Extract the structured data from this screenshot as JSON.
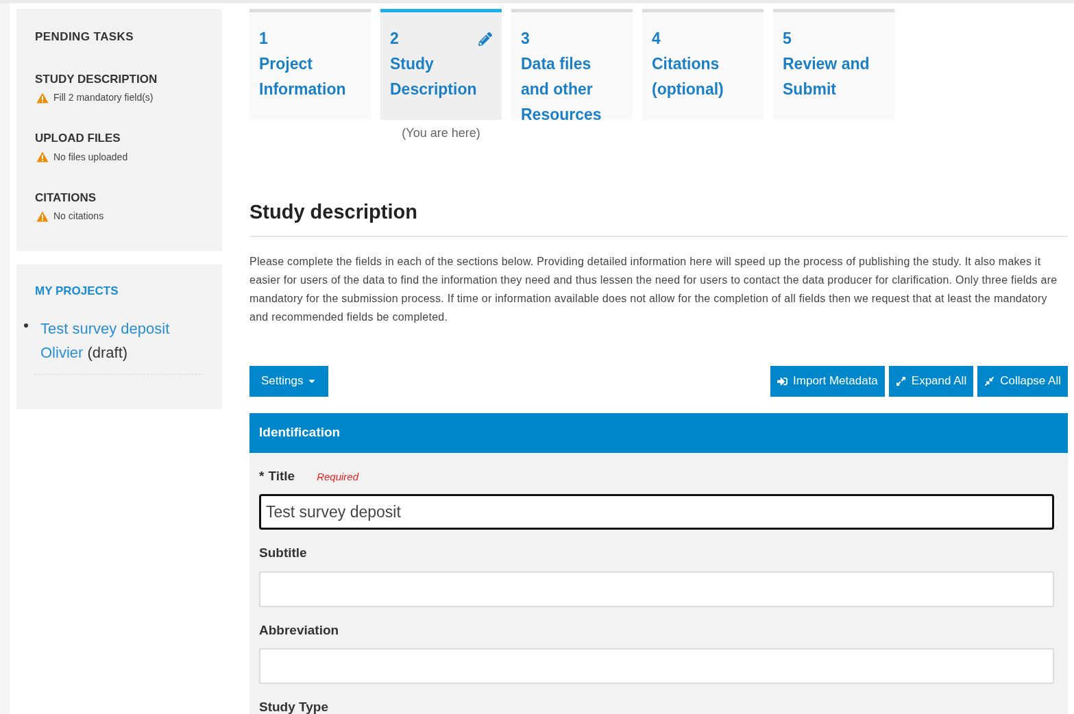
{
  "sidebar": {
    "pending": {
      "title": "PENDING TASKS",
      "tasks": [
        {
          "heading": "STUDY DESCRIPTION",
          "message": "Fill 2 mandatory field(s)"
        },
        {
          "heading": "UPLOAD FILES",
          "message": "No files uploaded"
        },
        {
          "heading": "CITATIONS",
          "message": "No citations"
        }
      ]
    },
    "projects": {
      "title": "MY PROJECTS",
      "items": [
        {
          "link": "Test survey deposit Olivier",
          "status": "(draft)"
        }
      ]
    }
  },
  "steps": [
    {
      "number": "1",
      "label": "Project Information",
      "selected": false
    },
    {
      "number": "2",
      "label": "Study Description",
      "selected": true,
      "note": "(You are here)"
    },
    {
      "number": "3",
      "label": "Data files and other Resources",
      "selected": false
    },
    {
      "number": "4",
      "label": "Citations (optional)",
      "selected": false
    },
    {
      "number": "5",
      "label": "Review and Submit",
      "selected": false
    }
  ],
  "heading": "Study description",
  "intro": "Please complete the fields in each of the sections below. Providing detailed information here will speed up the process of publishing the study. It also makes it easier for users of the data to find the information they need and thus lessen the need for users to contact the data producer for clarification. Only three fields are mandatory for the submission process. If time or information available does not allow for the completion of all fields then we request that at least the mandatory and recommended fields be completed.",
  "toolbar": {
    "settings": "Settings",
    "buttons": [
      {
        "kind": "import",
        "label": "Import Metadata"
      },
      {
        "kind": "expand",
        "label": "Expand All"
      },
      {
        "kind": "collapse",
        "label": "Collapse All"
      }
    ]
  },
  "section": {
    "title": "Identification",
    "fields": [
      {
        "label": "Title",
        "required_mark": "*",
        "hint": "Required",
        "value": "Test survey deposit",
        "focused": true
      },
      {
        "label": "Subtitle",
        "focused": false
      },
      {
        "label": "Abbreviation",
        "focused": false
      },
      {
        "label": "Study Type"
      }
    ]
  }
}
